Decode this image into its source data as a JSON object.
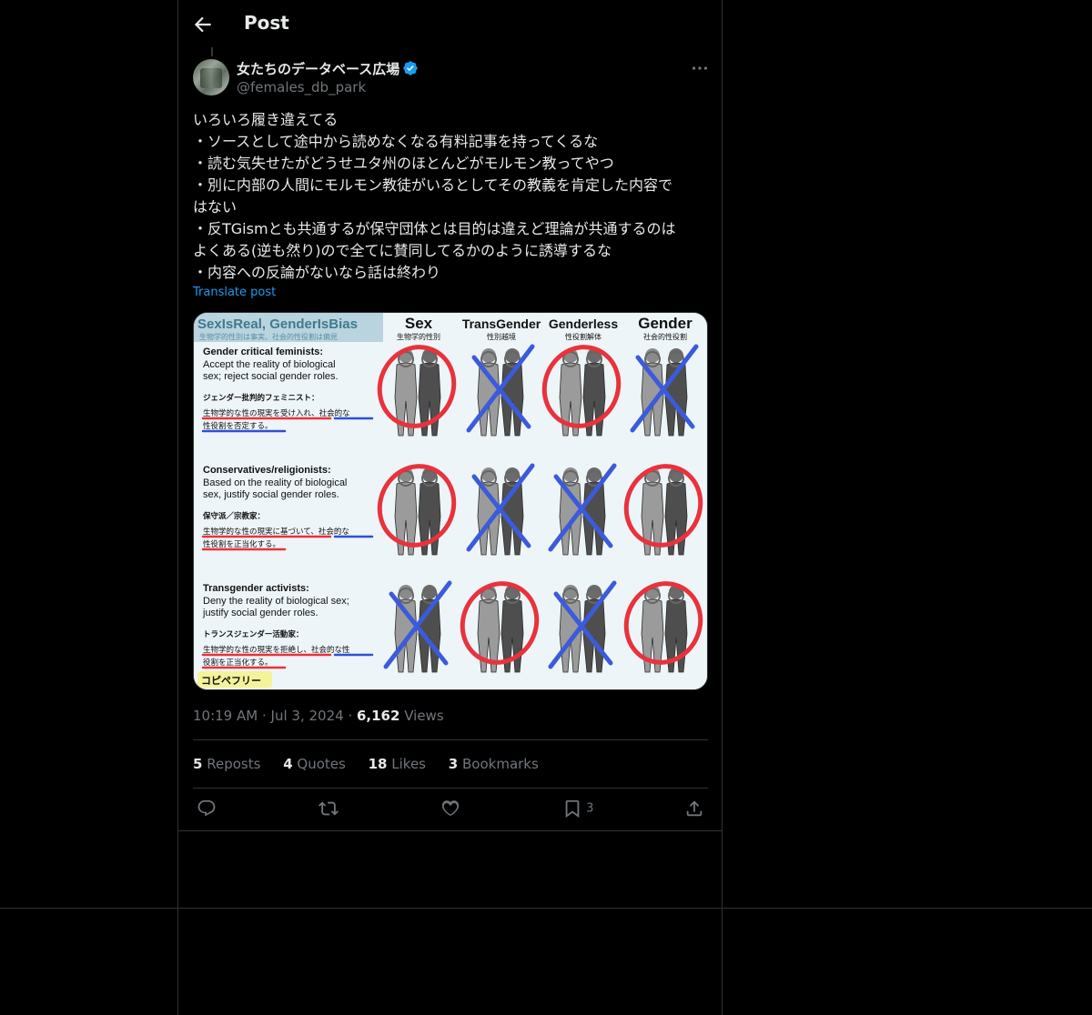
{
  "header": {
    "title": "Post"
  },
  "author": {
    "name": "女たちのデータベース広場",
    "handle": "@females_db_park"
  },
  "tweet": {
    "lines": [
      "いろいろ履き違えてる",
      "・ソースとして途中から読めなくなる有料記事を持ってくるな",
      "・読む気失せたがどうせユタ州のほとんどがモルモン教ってやつ",
      "・別に内部の人間にモルモン教徒がいるとしてその教義を肯定した内容で",
      "はない",
      "・反TGismとも共通するが保守団体とは目的は違えど理論が共通するのは",
      "よくある(逆も然り)ので全てに賛同してるかのように誘導するな",
      "・内容への反論がないなら話は終わり"
    ],
    "translate": "Translate post"
  },
  "image": {
    "title": "SexIsReal, GenderIsBias",
    "title_jp": "生物学的性別は事実、社会的性役割は偏見",
    "columns": [
      {
        "en": "Sex",
        "jp": "生物学的性別"
      },
      {
        "en": "TransGender",
        "jp": "性別越境"
      },
      {
        "en": "Genderless",
        "jp": "性役割解体"
      },
      {
        "en": "Gender",
        "jp": "社会的性役割"
      }
    ],
    "rows": [
      {
        "head": "Gender critical feminists:",
        "l1": "Accept the reality of biological",
        "l2": "sex; reject social gender roles.",
        "jp_head": "ジェンダー批判的フェミニスト：",
        "jp1": "生物学的な性の現実を受け入れ、社会的な",
        "jp2": "性役割を否定する。"
      },
      {
        "head": "Conservatives/religionists:",
        "l1": "Based on the reality of biological",
        "l2": "sex, justify social gender roles.",
        "jp_head": "保守派／宗教家：",
        "jp1": "生物学的な性の現実に基づいて、社会的な",
        "jp2": "性役割を正当化する。"
      },
      {
        "head": "Transgender activists:",
        "l1": "Deny the reality of biological sex;",
        "l2": "justify social gender roles.",
        "jp_head": "トランスジェンダー活動家：",
        "jp1": "生物学的な性の現実を拒絶し、社会的な性",
        "jp2": "役割を正当化する。"
      }
    ],
    "marks": [
      [
        "circle",
        "cross",
        "circle",
        "cross"
      ],
      [
        "circle",
        "cross",
        "cross",
        "circle"
      ],
      [
        "cross",
        "circle",
        "cross",
        "circle"
      ]
    ],
    "footer": "コピペフリー"
  },
  "meta": {
    "time": "10:19 AM",
    "date": "Jul 3, 2024",
    "views_count": "6,162",
    "views_label": "Views"
  },
  "stats": {
    "reposts_count": "5",
    "reposts_label": "Reposts",
    "quotes_count": "4",
    "quotes_label": "Quotes",
    "likes_count": "18",
    "likes_label": "Likes",
    "bookmarks_count": "3",
    "bookmarks_label": "Bookmarks"
  },
  "actions": {
    "bookmark_count": "3"
  },
  "colors": {
    "accent": "#1d9bf0",
    "verified": "#1d9bf0",
    "circle": "#e8323c",
    "cross": "#3b5bdb"
  }
}
